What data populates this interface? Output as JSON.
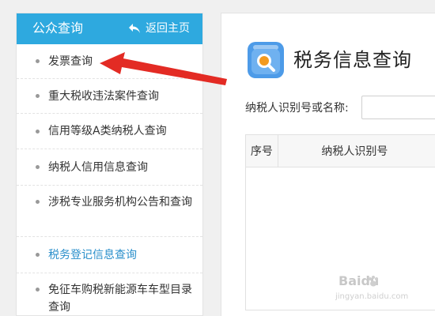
{
  "sidebar": {
    "title": "公众查询",
    "back_label": "返回主页",
    "items": [
      {
        "label": "发票查询"
      },
      {
        "label": "重大税收违法案件查询"
      },
      {
        "label": "信用等级A类纳税人查询"
      },
      {
        "label": "纳税人信用信息查询"
      },
      {
        "label": "涉税专业服务机构公告和查询"
      },
      {
        "label": "税务登记信息查询",
        "active": true
      },
      {
        "label": "免征车购税新能源车车型目录查询"
      }
    ]
  },
  "main": {
    "title": "税务信息查询",
    "icon": "search-magnifier-icon",
    "search": {
      "label": "纳税人识别号或名称:",
      "value": "",
      "placeholder": ""
    },
    "table": {
      "columns": [
        "序号",
        "纳税人识别号"
      ]
    }
  },
  "annotation": {
    "icon": "red-arrow-pointer",
    "color": "#e32b24"
  },
  "watermark": {
    "brand": "Baidu",
    "sub": "jingyan.baidu.com"
  },
  "colors": {
    "header_bg": "#2ea9df",
    "active_text": "#2a8fcb",
    "icon_bg": "#4d9be8",
    "icon_accent": "#f39a1f"
  }
}
